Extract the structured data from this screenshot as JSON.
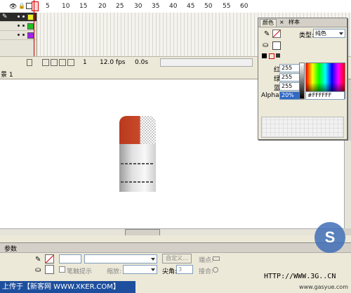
{
  "timeline": {
    "frame_numbers": [
      "1",
      "5",
      "10",
      "15",
      "20",
      "25",
      "30",
      "35",
      "40",
      "45",
      "50",
      "55",
      "60"
    ],
    "status": {
      "current_frame": "1",
      "fps": "12.0 fps",
      "elapsed": "0.0s"
    },
    "layer_colors": [
      "#f0f020",
      "#20c020",
      "#a020f0"
    ]
  },
  "scene": {
    "label": "景 1"
  },
  "mixer": {
    "tabs": [
      "颜色",
      "样本"
    ],
    "type_label": "类型:",
    "type_value": "纯色",
    "red_label": "红:",
    "red_value": "255",
    "green_label": "绿:",
    "green_value": "255",
    "blue_label": "蓝:",
    "blue_value": "255",
    "alpha_label": "Alpha:",
    "alpha_value": "20%",
    "hex_value": "#FFFFFF"
  },
  "properties": {
    "tab_label": "参数",
    "custom_button": "自定义...",
    "endpoint_label": "端点:",
    "stroke_hint_label": "笔触提示",
    "scale_label": "缩放:",
    "miter_label": "尖角:",
    "miter_value": "3",
    "join_label": "接合:"
  },
  "watermark": {
    "left_text": "上传于【新客网 WWW.XKER.COM】",
    "url": "HTTP://WWW.3G..CN",
    "right_text": "www.gasyue.com"
  },
  "colors": {
    "artwork_red": "#c9482a",
    "accent_blue": "#1e4f9e"
  }
}
